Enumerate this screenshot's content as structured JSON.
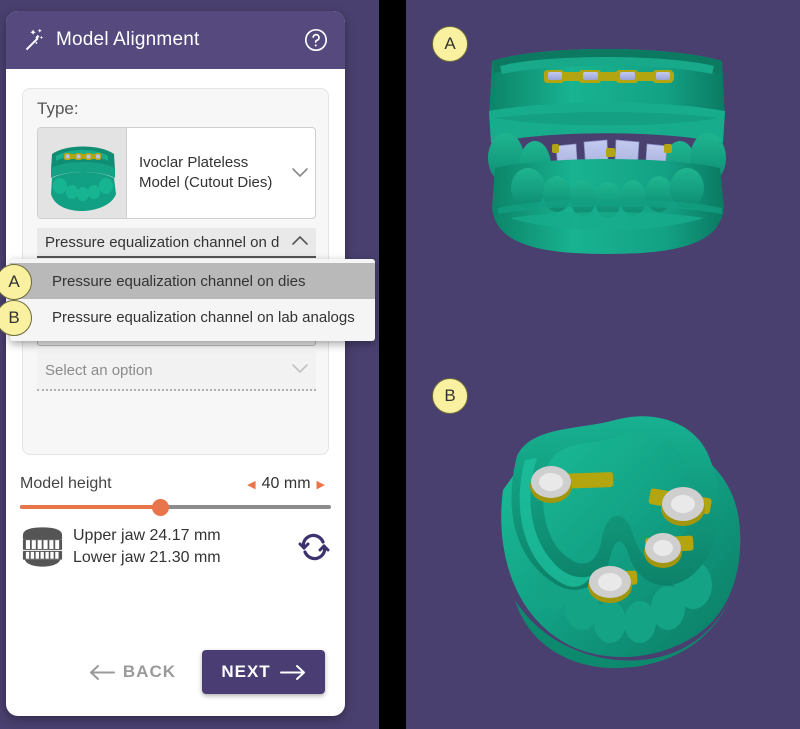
{
  "window": {
    "title": "Model Alignment",
    "wand_icon": "magic-wand-icon",
    "help_icon": "help-circle-icon"
  },
  "form": {
    "type_label": "Type:",
    "type_value": "Ivoclar Plateless Model (Cutout Dies)",
    "type_thumbnail": "dental-model-thumbnail",
    "combo_value": "Pressure equalization channel on d",
    "combo_caret": "chevron-up-icon",
    "select_placeholder_1": "Select an option",
    "select_placeholder_2": "Select an option",
    "caret_icon": "chevron-down-icon"
  },
  "dropdown": {
    "options": [
      {
        "badge": "A",
        "label": "Pressure equalization channel on dies",
        "selected": true
      },
      {
        "badge": "B",
        "label": "Pressure equalization channel on lab analogs",
        "selected": false
      }
    ]
  },
  "slider": {
    "label": "Model height",
    "value": "40 mm",
    "decrement_icon": "arrow-left-icon",
    "increment_icon": "arrow-right-icon",
    "fill_percent": 45,
    "track_color": "#8c8c8c",
    "accent_color": "#e8764a"
  },
  "jaw": {
    "icon": "dentures-icon",
    "upper": "Upper jaw 24.17 mm",
    "lower": "Lower jaw 21.30 mm",
    "refresh_icon": "sync-refresh-icon"
  },
  "footer": {
    "back_label": "BACK",
    "back_icon": "arrow-left-icon",
    "next_label": "NEXT",
    "next_icon": "arrow-right-icon"
  },
  "viewport": {
    "badge_a": "A",
    "badge_b": "B",
    "model_a_name": "upper-lower-jaw-front-view",
    "model_b_name": "lower-jaw-lab-analogs-view",
    "background_color": "#4a4070",
    "model_color": "#16a085",
    "die_color": "#a9b0e0",
    "channel_color": "#b2a50f"
  },
  "colors": {
    "header": "#55497e",
    "primary": "#4a3d73",
    "accent": "#e8764a",
    "badge": "#f9f0a0"
  }
}
